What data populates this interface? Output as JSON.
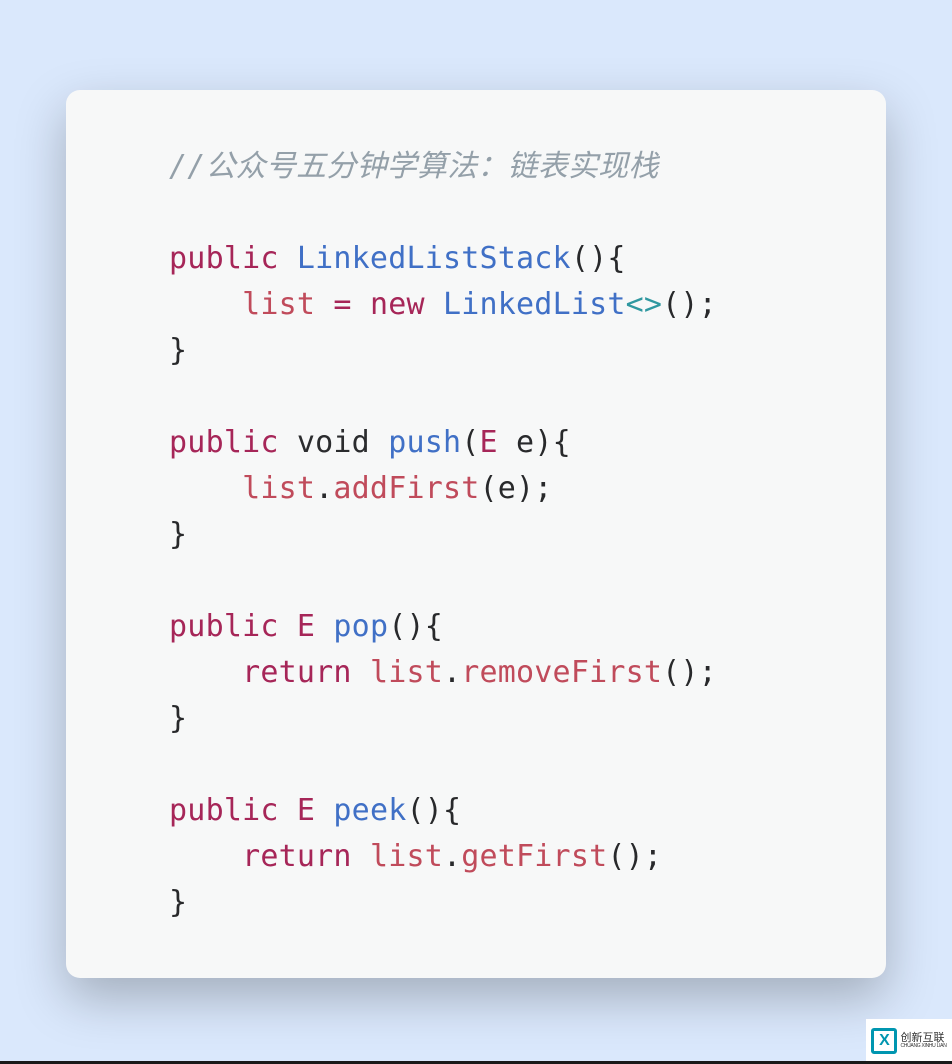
{
  "code": {
    "comment": "//公众号五分钟学算法：链表实现栈",
    "publicKw": "public",
    "voidKw": "void",
    "returnKw": "return",
    "newKw": "new",
    "constructor": {
      "name": "LinkedListStack",
      "body": {
        "lhs": "list",
        "assign": "=",
        "rhsClass": "LinkedList",
        "generic": "<>",
        "parens": "();"
      }
    },
    "push": {
      "name": "push",
      "paramType": "E",
      "paramName": "e",
      "body": {
        "obj": "list",
        "dot": ".",
        "method": "addFirst",
        "args": "(e);"
      }
    },
    "pop": {
      "returnType": "E",
      "name": "pop",
      "body": {
        "obj": "list",
        "dot": ".",
        "method": "removeFirst",
        "args": "();"
      }
    },
    "peek": {
      "returnType": "E",
      "name": "peek",
      "body": {
        "obj": "list",
        "dot": ".",
        "method": "getFirst",
        "args": "();"
      }
    },
    "openParen": "(",
    "closeParen": ")",
    "openBrace": "{",
    "closeBrace": "}",
    "space": " ",
    "indent4": "    ",
    "indent8": "        "
  },
  "watermark": {
    "logo": "X",
    "line1": "创新互联",
    "line2": "CHUANG XINHU LIAN"
  }
}
